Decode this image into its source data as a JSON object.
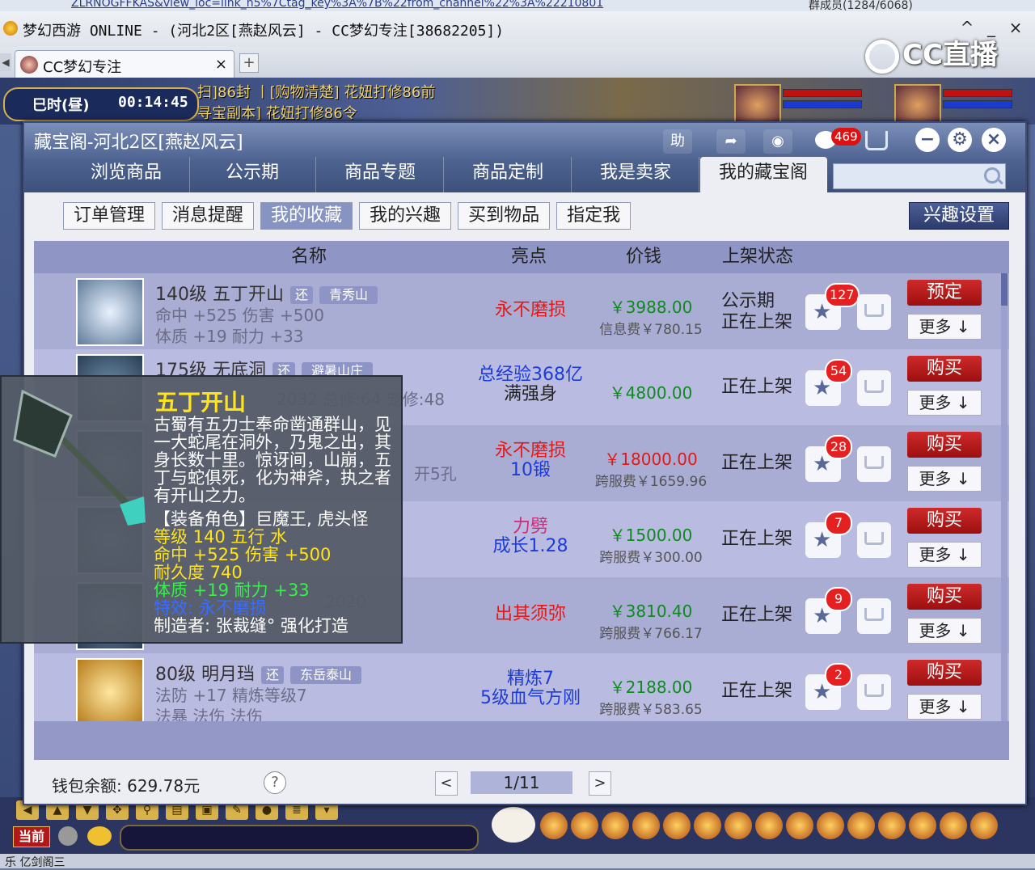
{
  "window": {
    "url_fragment": "ZLRNOGFFKAS&view_loc=link_h5%7Ctag_key%3A%7B%22from_channel%22%3A%22210801",
    "group_info": "群成员(1284/6068)",
    "title": "梦幻西游 ONLINE - (河北2区[燕赵风云] - CC梦幻专注[38682205])",
    "minimize": "_",
    "maximize": "^",
    "close": "×"
  },
  "branding": {
    "name": "CC直播"
  },
  "browser_tab": {
    "label": "CC梦幻专注",
    "close": "×",
    "add": "+"
  },
  "game": {
    "time_label": "巳时(昼)",
    "time_value": "00:14:45",
    "quest_line1": "扫]86封 丨[购物清楚] 花妞打修86前",
    "quest_line2": "寻宝副本] 花妞打修86令"
  },
  "dialog": {
    "title": "藏宝阁-河北2区[燕赵风云]",
    "help_btn": "助",
    "chat_count": "469",
    "nav": [
      "浏览商品",
      "公示期",
      "商品专题",
      "商品定制",
      "我是卖家",
      "我的藏宝阁"
    ],
    "search_placeholder": "",
    "subtabs": [
      "订单管理",
      "消息提醒",
      "我的收藏",
      "我的兴趣",
      "买到物品",
      "指定我"
    ],
    "interest_btn": "兴趣设置",
    "columns": [
      "名称",
      "亮点",
      "价钱",
      "上架状态"
    ],
    "more_label": "更多",
    "rows": [
      {
        "name": "140级 五丁开山",
        "tag1": "还",
        "tag2": "青秀山",
        "attr1": "命中 +525 伤害 +500",
        "attr2": "体质 +19 耐力 +33",
        "highlight": [
          "永不磨损"
        ],
        "price": "￥3988.00",
        "fee": "信息费￥780.15",
        "status": [
          "公示期",
          "正在上架"
        ],
        "fav_count": "127",
        "action": "预定"
      },
      {
        "name": "175级 无底洞",
        "tag1": "还",
        "tag2": "避暑山庄",
        "attr1": "2032 总修:64 宠修:48",
        "attr2": "",
        "highlight": [
          "总经验368亿",
          "满强身"
        ],
        "price": "￥4800.00",
        "fee": "",
        "status": [
          "正在上架"
        ],
        "fav_count": "54",
        "action": "购买"
      },
      {
        "name": "",
        "tag1": "",
        "tag2": "",
        "attr1": "开5孔",
        "attr2": "",
        "highlight": [
          "永不磨损",
          "10锻"
        ],
        "price": "￥18000.00",
        "fee": "跨服费￥1659.96",
        "status": [
          "正在上架"
        ],
        "fav_count": "28",
        "action": "购买"
      },
      {
        "name": "",
        "tag1": "",
        "tag2": "",
        "attr1": "",
        "attr2": "",
        "highlight": [
          "力劈",
          "成长1.28"
        ],
        "price": "￥1500.00",
        "fee": "跨服费￥300.00",
        "status": [
          "正在上架"
        ],
        "fav_count": "7",
        "action": "购买"
      },
      {
        "name": "",
        "tag1": "",
        "tag2": "",
        "attr1": "2020",
        "attr2": "",
        "highlight": [
          "出其须弥"
        ],
        "price": "￥3810.40",
        "fee": "跨服费￥766.17",
        "status": [
          "正在上架"
        ],
        "fav_count": "9",
        "action": "购买"
      },
      {
        "name": "80级 明月珰",
        "tag1": "还",
        "tag2": "东岳泰山",
        "attr1": "法防 +17 精炼等级7",
        "attr2": "法暴 法伤 法伤",
        "highlight": [
          "精炼7",
          "5级血气方刚"
        ],
        "price": "￥2188.00",
        "fee": "跨服费￥583.65",
        "status": [
          "正在上架"
        ],
        "fav_count": "2",
        "action": "购买"
      }
    ],
    "wallet": "钱包余额: 629.78元",
    "help": "?",
    "page": "1/11",
    "prev": "<",
    "next": ">"
  },
  "tooltip": {
    "title": "五丁开山",
    "desc": "古蜀有五力士奉命凿通群山，见一大蛇尾在洞外，乃鬼之出，其身长数十里。惊讶间，山崩，五丁与蛇俱死，化为神斧，执之者有开山之力。",
    "role": "【装备角色】巨魔王, 虎头怪",
    "level_line": "等级 140  五行 水",
    "stat_line": "命中 +525 伤害 +500",
    "durability": "耐久度 740",
    "attr_line": "体质 +19 耐力 +33",
    "special": "特效: 永不磨损",
    "maker": "制造者: 张裁缝° 强化打造"
  },
  "bottom": {
    "channel": "当前",
    "status_text": "乐  亿剑阁三"
  }
}
